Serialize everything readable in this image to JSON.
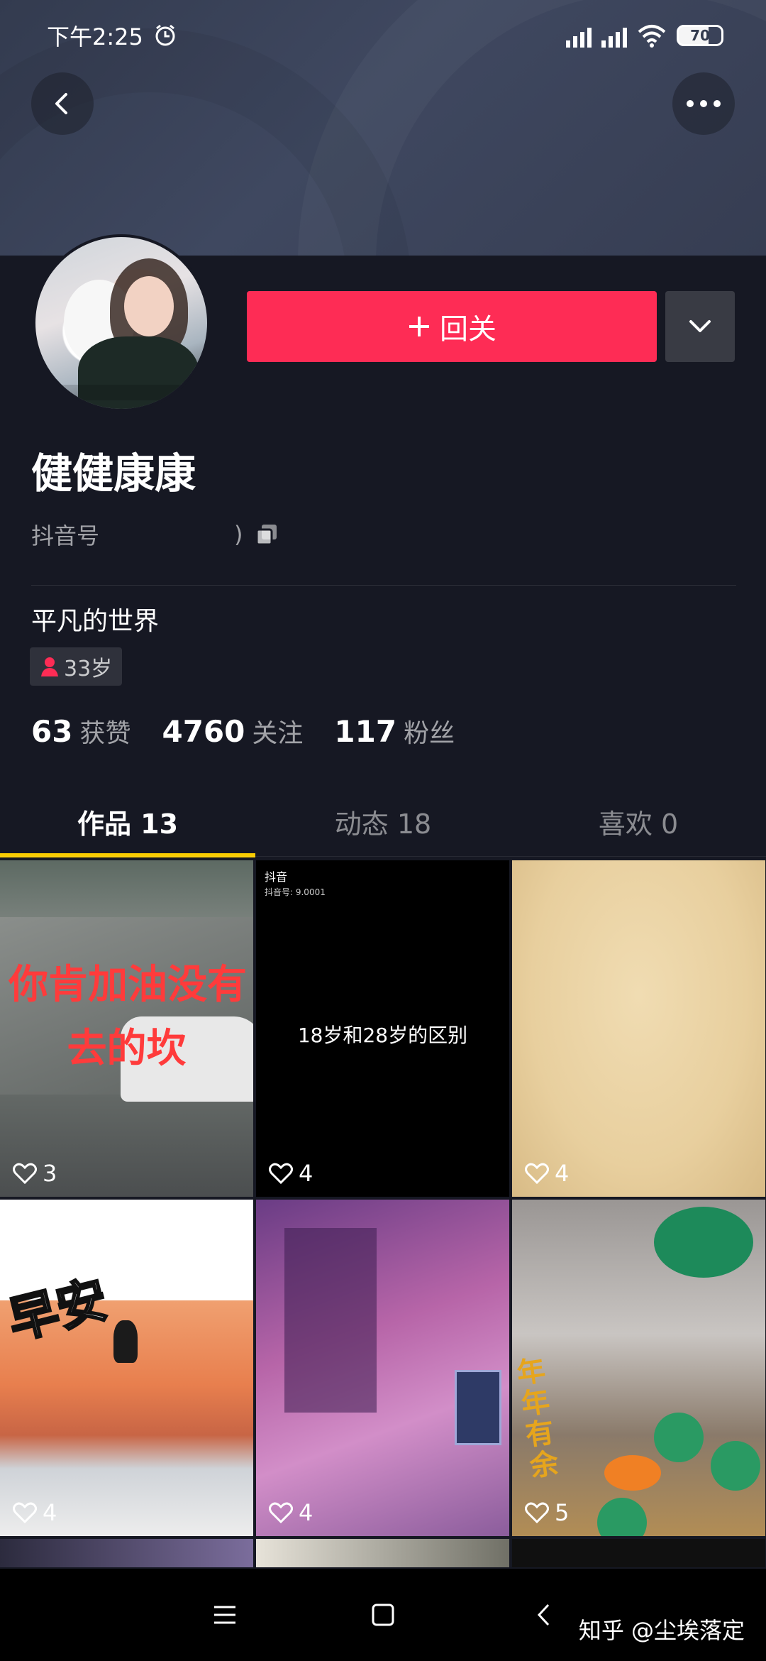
{
  "status_bar": {
    "time": "下午2:25",
    "battery": "70"
  },
  "profile": {
    "follow_button_label": "回关",
    "nickname": "健健康康",
    "douyin_id_label": "抖音号",
    "douyin_id_value": ")",
    "bio": "平凡的世界",
    "age": "33岁"
  },
  "stats": [
    {
      "num": "63",
      "label": "获赞"
    },
    {
      "num": "4760",
      "label": "关注"
    },
    {
      "num": "117",
      "label": "粉丝"
    }
  ],
  "tabs": [
    {
      "label": "作品 13",
      "active": true
    },
    {
      "label": "动态 18",
      "active": false
    },
    {
      "label": "喜欢 0",
      "active": false
    }
  ],
  "videos": [
    {
      "likes": "3",
      "overlay_line1": "你肯加油没有",
      "overlay_line2": "去的坎"
    },
    {
      "likes": "4",
      "overlay": "18岁和28岁的区别",
      "logo": "抖音",
      "id_small": "抖音号: 9.0001"
    },
    {
      "likes": "4"
    },
    {
      "likes": "4",
      "overlay": "早安"
    },
    {
      "likes": "4"
    },
    {
      "likes": "5",
      "overlay": "年年有余"
    }
  ],
  "watermark": "知乎 @尘埃落定",
  "colors": {
    "accent": "#fe2c55",
    "tab_indicator": "#facd00",
    "background": "#161823"
  }
}
